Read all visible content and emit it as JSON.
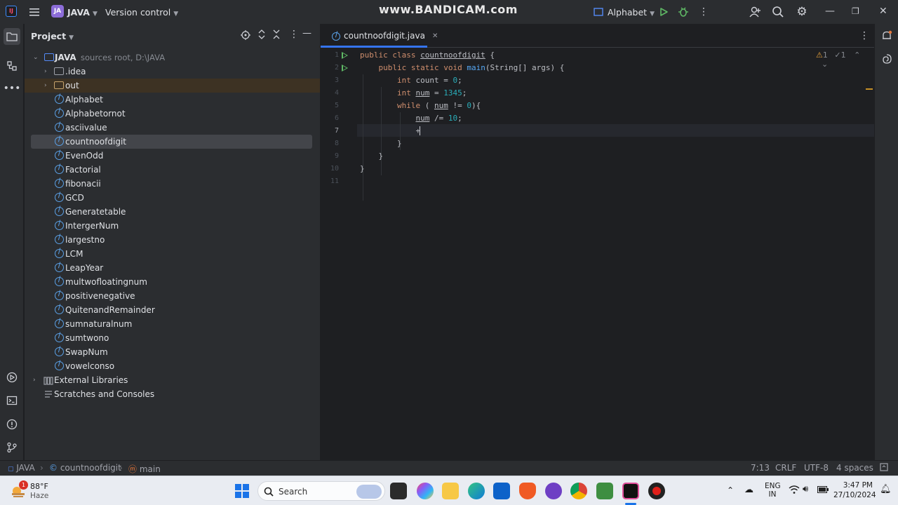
{
  "titlebar": {
    "logo": "IJ",
    "project_badge": "JA",
    "project_name": "JAVA",
    "vcs": "Version control",
    "watermark_main": "www.BANDICAM",
    "watermark_tld": ".com",
    "run_config": "Alphabet"
  },
  "project_panel": {
    "title": "Project",
    "root": {
      "name": "JAVA",
      "hint": "sources root,  D:\\JAVA"
    },
    "folders": [
      ".idea",
      "out"
    ],
    "files": [
      "Alphabet",
      "Alphabetornot",
      "asciivalue",
      "countnoofdigit",
      "EvenOdd",
      "Factorial",
      "fibonacii",
      "GCD",
      "Generatetable",
      "IntergerNum",
      "largestno",
      "LCM",
      "LeapYear",
      "multwofloatingnum",
      "positivenegative",
      "QuitenandRemainder",
      "sumnaturalnum",
      "sumtwono",
      "SwapNum",
      "vowelconso"
    ],
    "selected": "countnoofdigit",
    "extras": [
      "External Libraries",
      "Scratches and Consoles"
    ]
  },
  "editor": {
    "tab": "countnoofdigit.java",
    "inspections": {
      "warnings": "1",
      "weak": "1"
    },
    "line_numbers": [
      "1",
      "2",
      "3",
      "4",
      "5",
      "6",
      "7",
      "8",
      "9",
      "10",
      "11"
    ],
    "current_line": "7",
    "code": [
      [
        {
          "t": "public class ",
          "c": "kw"
        },
        {
          "t": "countnoofdigit",
          "c": "cls"
        },
        {
          "t": " {",
          "c": "var"
        }
      ],
      [
        {
          "t": "    public static void ",
          "c": "kw"
        },
        {
          "t": "main",
          "c": "fn"
        },
        {
          "t": "(String[] args) {",
          "c": "var"
        }
      ],
      [
        {
          "t": "        int ",
          "c": "kw"
        },
        {
          "t": "count",
          "c": "var"
        },
        {
          "t": " = ",
          "c": "var"
        },
        {
          "t": "0",
          "c": "num"
        },
        {
          "t": ";",
          "c": "var"
        }
      ],
      [
        {
          "t": "        int ",
          "c": "kw"
        },
        {
          "t": "num",
          "c": "cls"
        },
        {
          "t": " = ",
          "c": "var"
        },
        {
          "t": "1345",
          "c": "num"
        },
        {
          "t": ";",
          "c": "var"
        }
      ],
      [
        {
          "t": "        while ",
          "c": "kw"
        },
        {
          "t": "( ",
          "c": "var"
        },
        {
          "t": "num",
          "c": "cls"
        },
        {
          "t": " != ",
          "c": "var"
        },
        {
          "t": "0",
          "c": "num"
        },
        {
          "t": "){",
          "c": "var"
        }
      ],
      [
        {
          "t": "            ",
          "c": "var"
        },
        {
          "t": "num",
          "c": "cls"
        },
        {
          "t": " /= ",
          "c": "var"
        },
        {
          "t": "10",
          "c": "num"
        },
        {
          "t": ";",
          "c": "var"
        }
      ],
      [
        {
          "t": "            +",
          "c": "var"
        }
      ],
      [
        {
          "t": "        }",
          "c": "var"
        }
      ],
      [
        {
          "t": "    }",
          "c": "var"
        }
      ],
      [
        {
          "t": "}",
          "c": "var"
        }
      ],
      [
        {
          "t": "",
          "c": "var"
        }
      ]
    ]
  },
  "statusbar": {
    "crumbs": [
      "JAVA",
      "countnoofdigit",
      "main"
    ],
    "position": "7:13",
    "line_sep": "CRLF",
    "encoding": "UTF-8",
    "indent": "4 spaces"
  },
  "taskbar": {
    "weather_temp": "88°F",
    "weather_desc": "Haze",
    "weather_badge": "1",
    "search_placeholder": "Search",
    "lang_top": "ENG",
    "lang_bottom": "IN",
    "time": "3:47 PM",
    "date": "27/10/2024"
  }
}
